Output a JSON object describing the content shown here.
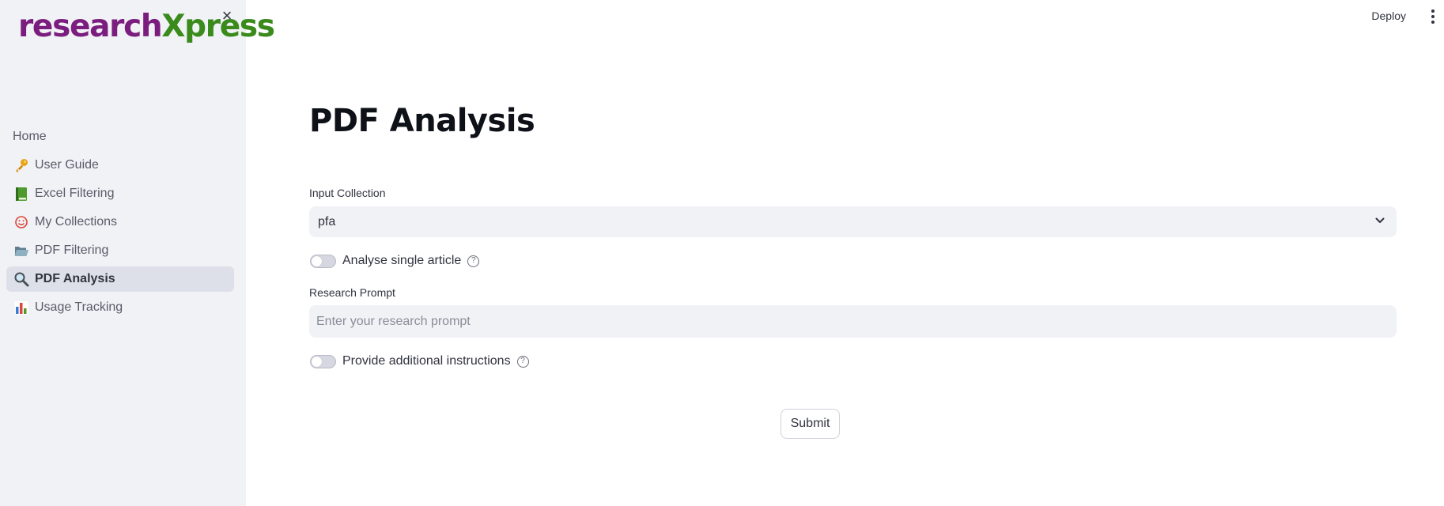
{
  "sidebar": {
    "logo": {
      "part1": "research",
      "part2": "Xpress"
    },
    "close_label": "×",
    "items": [
      {
        "label": "Home",
        "icon": "none",
        "active": false
      },
      {
        "label": "User Guide",
        "icon": "key-icon",
        "active": false
      },
      {
        "label": "Excel Filtering",
        "icon": "green-book-icon",
        "active": false
      },
      {
        "label": "My Collections",
        "icon": "smiley-icon",
        "active": false
      },
      {
        "label": "PDF Filtering",
        "icon": "open-folder-icon",
        "active": false
      },
      {
        "label": "PDF Analysis",
        "icon": "magnifier-icon",
        "active": true
      },
      {
        "label": "Usage Tracking",
        "icon": "bar-chart-icon",
        "active": false
      }
    ]
  },
  "topbar": {
    "deploy_label": "Deploy"
  },
  "main": {
    "title": "PDF Analysis",
    "input_collection": {
      "label": "Input Collection",
      "value": "pfa"
    },
    "single_article_toggle": {
      "label": "Analyse single article",
      "checked": false
    },
    "research_prompt": {
      "label": "Research Prompt",
      "placeholder": "Enter your research prompt",
      "value": ""
    },
    "additional_instructions_toggle": {
      "label": "Provide additional instructions",
      "checked": false
    },
    "submit_label": "Submit"
  },
  "colors": {
    "logo_purple": "#7b1d7e",
    "logo_green": "#3a8a1c",
    "sidebar_bg": "#f0f2f6",
    "active_item_bg": "#dde0e8"
  }
}
